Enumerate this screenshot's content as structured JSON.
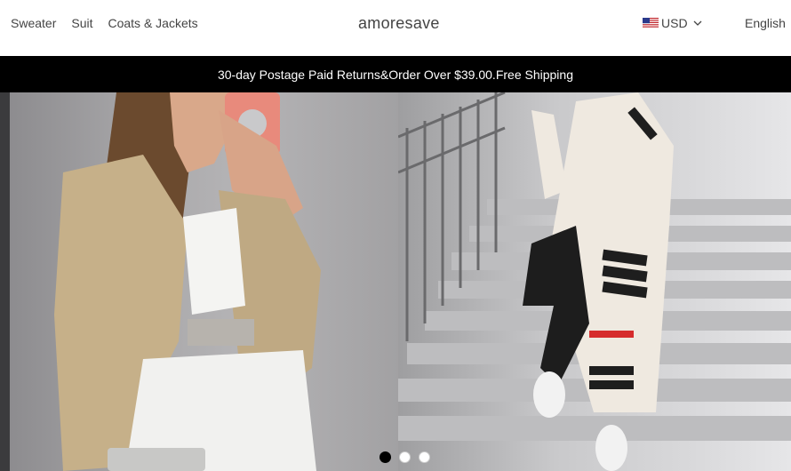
{
  "nav": {
    "items": [
      {
        "label": "Sweater"
      },
      {
        "label": "Suit"
      },
      {
        "label": "Coats & Jackets"
      }
    ]
  },
  "brand": {
    "name": "amoresave"
  },
  "currency": {
    "code": "USD",
    "flag_icon": "us-flag-icon"
  },
  "language": {
    "label": "English"
  },
  "announcement": {
    "text": "30-day Postage Paid Returns&Order Over $39.00.Free Shipping"
  },
  "hero": {
    "slides": [
      {
        "image": "model-gold-sequin-jacket"
      },
      {
        "image": "model-striped-long-cardigan"
      }
    ],
    "active_index": 0,
    "dot_count": 3
  },
  "colors": {
    "announce_bg": "#000000",
    "header_bg": "#ffffff",
    "text": "#444444"
  }
}
